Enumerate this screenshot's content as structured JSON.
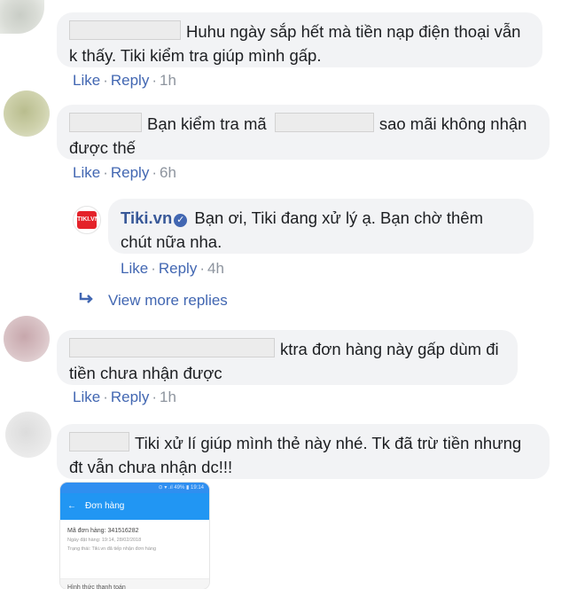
{
  "comments": [
    {
      "text_line1": "Huhu ngày sắp hết mà tiền nạp điện thoại vẫn",
      "text_line2": "k thấy. Tiki kiểm tra giúp mình gấp.",
      "like": "Like",
      "reply": "Reply",
      "time": "1h"
    },
    {
      "text_before": "Bạn kiểm tra mã",
      "text_after": "sao mãi không nhận",
      "text_line2": "được thế",
      "like": "Like",
      "reply": "Reply",
      "time": "6h"
    },
    {
      "text_after": "ktra đơn hàng này gấp dùm đi",
      "text_line2": "tiền chưa nhận được",
      "like": "Like",
      "reply": "Reply",
      "time": "1h"
    },
    {
      "text_line1": "Tiki xử lí giúp mình thẻ này nhé. Tk đã trừ tiền nhưng",
      "text_line2": "đt vẫn chưa nhận dc!!!"
    }
  ],
  "reply": {
    "author": "Tiki.vn",
    "text_line1": "Bạn ơi, Tiki đang xử lý ạ. Bạn chờ thêm",
    "text_line2": "chút nữa nha.",
    "like": "Like",
    "reply": "Reply",
    "time": "4h",
    "logo_text": "TIKI.VN"
  },
  "view_more_replies": "View more replies",
  "phone_screenshot": {
    "status": "⊙ ▾ .ıl 49% ▮ 19:14",
    "title": "Đơn hàng",
    "order_line": "Mã đơn hàng: 341516282",
    "date_line": "Ngày đặt hàng: 19:14, 28/02/2018",
    "state_line": "Trạng thái: Tiki.vn đã tiếp nhận đơn hàng",
    "section": "Hình thức thanh toán"
  },
  "colors": {
    "link": "#4267b2",
    "meta": "#8d949e",
    "bubble": "#f2f3f5",
    "author": "#385898"
  }
}
